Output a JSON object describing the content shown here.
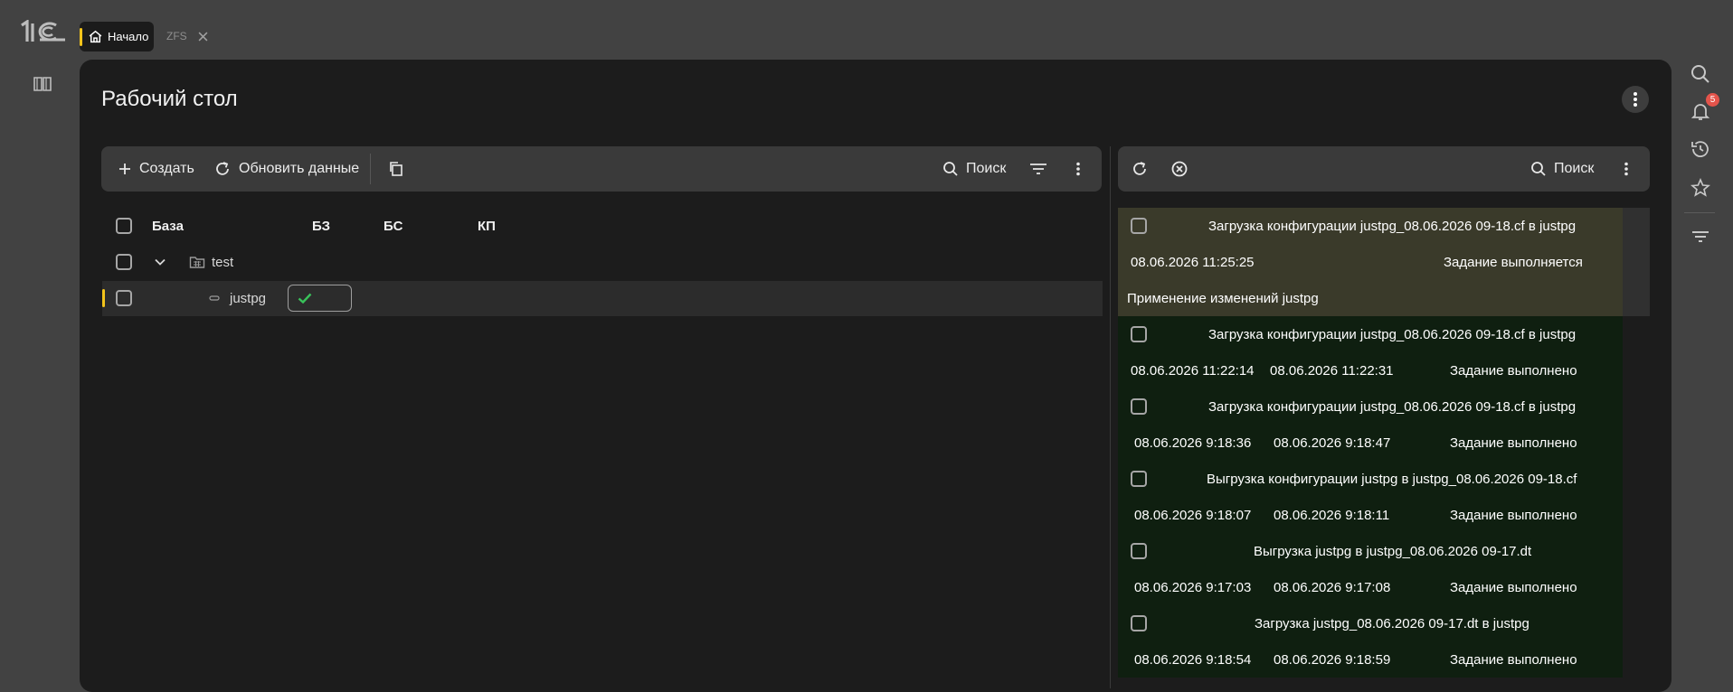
{
  "app": {
    "logo": "1С"
  },
  "tabs": [
    {
      "label": "Начало",
      "icon": "home-icon",
      "active": true
    },
    {
      "label": "ZFS",
      "icon": "close-icon",
      "active": false
    }
  ],
  "page": {
    "title": "Рабочий стол"
  },
  "left_toolbar": {
    "create": "Создать",
    "refresh": "Обновить данные",
    "search": "Поиск"
  },
  "right_toolbar": {
    "search": "Поиск"
  },
  "table": {
    "columns": [
      "База",
      "БЗ",
      "БС",
      "КП"
    ],
    "rows": [
      {
        "name": "test",
        "type": "group",
        "expanded": true
      },
      {
        "name": "justpg",
        "type": "item",
        "bz": "check",
        "selected": true
      }
    ]
  },
  "notifications": {
    "count": "5"
  },
  "jobs": [
    {
      "title": "Загрузка конфигурации justpg_08.06.2026 09-18.cf в justpg",
      "start": "08.06.2026 11:25:25",
      "end": "",
      "status": "Задание выполняется",
      "detail": "Применение изменений justpg",
      "state": "running"
    },
    {
      "title": "Загрузка конфигурации justpg_08.06.2026 09-18.cf в justpg",
      "start": "08.06.2026 11:22:14",
      "end": "08.06.2026 11:22:31",
      "status": "Задание выполнено",
      "state": "done"
    },
    {
      "title": "Загрузка конфигурации justpg_08.06.2026 09-18.cf в justpg",
      "start": "08.06.2026 9:18:36",
      "end": "08.06.2026 9:18:47",
      "status": "Задание выполнено",
      "state": "done"
    },
    {
      "title": "Выгрузка конфигурации justpg в justpg_08.06.2026 09-18.cf",
      "start": "08.06.2026 9:18:07",
      "end": "08.06.2026 9:18:11",
      "status": "Задание выполнено",
      "state": "done"
    },
    {
      "title": "Выгрузка justpg в justpg_08.06.2026 09-17.dt",
      "start": "08.06.2026 9:17:03",
      "end": "08.06.2026 9:17:08",
      "status": "Задание выполнено",
      "state": "done"
    },
    {
      "title": "Загрузка justpg_08.06.2026 09-17.dt в justpg",
      "start": "08.06.2026 9:18:54",
      "end": "08.06.2026 9:18:59",
      "status": "Задание выполнено",
      "state": "done"
    }
  ],
  "colors": {
    "accent": "#f2c31b",
    "job_running_bg": "#3a3a2a",
    "job_done_bg": "#0f1f10",
    "check": "#39c25a",
    "badge": "#e4544b"
  }
}
